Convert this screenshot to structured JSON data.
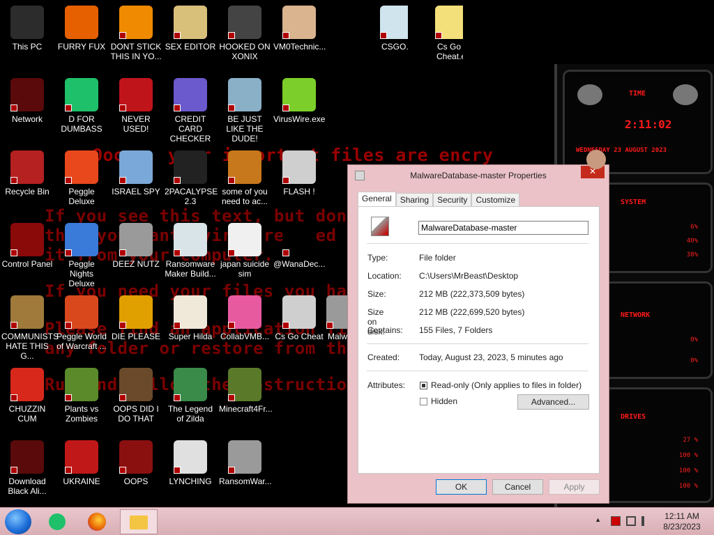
{
  "wallpaper": {
    "lines": [
      "Ooops, your important files are encry",
      "If you see this text, but don't",
      "then your anti-virus removed the",
      "it from your computer.",
      "If you need your files you have",
      "Please find an application file",
      "any folder or restore from the",
      "Run and follow the instructions"
    ]
  },
  "desktop_icons": [
    {
      "label": "This PC",
      "icon": "this-pc-icon",
      "color": "#2c2c2c"
    },
    {
      "label": "FURRY FUX",
      "icon": "firefox-icon",
      "color": "#e66000"
    },
    {
      "label": "DONT STICK THIS IN YO...",
      "icon": "vlc-cone-icon",
      "color": "#f08a00"
    },
    {
      "label": "SEX EDITOR",
      "icon": "hxd-editor-icon",
      "color": "#d9c07a"
    },
    {
      "label": "HOOKED ON XONIX",
      "icon": "xonix-game-icon",
      "color": "#444444"
    },
    {
      "label": "VM0Technic...",
      "icon": "doctor-avatar-icon",
      "color": "#d9b48f"
    },
    {
      "label": "CSGO.exe",
      "icon": "window-app-icon",
      "color": "#cfe4ec"
    },
    {
      "label": "Cs Go Cheat.exe",
      "icon": "cs-go-icon",
      "color": "#f4e07a"
    },
    {
      "label": "Network",
      "icon": "alienware-network-icon",
      "color": "#5a0a0a"
    },
    {
      "label": "D FOR DUMBASS",
      "icon": "chat-bubble-icon",
      "color": "#1fc06a"
    },
    {
      "label": "NEVER USED!",
      "icon": "dev-cpp-icon",
      "color": "#c0141b"
    },
    {
      "label": "CREDIT CARD CHECKER",
      "icon": "credit-card-icon",
      "color": "#6a5acd"
    },
    {
      "label": "BE JUST LIKE THE DUDE!",
      "icon": "santa-gnome-icon",
      "color": "#8ab0c8"
    },
    {
      "label": "VirusWire.exe",
      "icon": "lime-slice-icon",
      "color": "#7ccf2a"
    },
    {
      "label": "Recycle Bin",
      "icon": "recycle-bin-icon",
      "color": "#b52020"
    },
    {
      "label": "Peggle Deluxe",
      "icon": "peggle-icon",
      "color": "#e8481c"
    },
    {
      "label": "ISRAEL SPY",
      "icon": "network-computers-icon",
      "color": "#7aa8d8"
    },
    {
      "label": "2PACALYPSE 2.3",
      "icon": "terminal-icon",
      "color": "#222222"
    },
    {
      "label": "some of you need to ac...",
      "icon": "dog-meme-icon",
      "color": "#c8781c"
    },
    {
      "label": "FLASH !",
      "icon": "flash-card-icon",
      "color": "#cfcfcf"
    },
    {
      "label": "Control Panel",
      "icon": "control-panel-icon",
      "color": "#8a0a0a"
    },
    {
      "label": "Peggle Nights Deluxe",
      "icon": "peggle-nights-icon",
      "color": "#3a7ad8"
    },
    {
      "label": "DEEZ NUTZ",
      "icon": "stacked-windows-icon",
      "color": "#9a9a9a"
    },
    {
      "label": "Ransomware Maker Build...",
      "icon": "window-app-icon",
      "color": "#d8e4e8"
    },
    {
      "label": "japan suicide sim",
      "icon": "document-icon",
      "color": "#f0f0f0"
    },
    {
      "label": "@WanaDec...",
      "icon": "wanadecrypt-icon",
      "color": "#000000"
    },
    {
      "label": "COMMUNISTS HATE THIS G...",
      "icon": "money-bag-icon",
      "color": "#a07a3a"
    },
    {
      "label": "Peggle World of Warcraft ...",
      "icon": "peggle-wow-icon",
      "color": "#d8481c"
    },
    {
      "label": "DIE PLEASE",
      "icon": "adobe-de-icon",
      "color": "#e0a000"
    },
    {
      "label": "Super Hilda",
      "icon": "pixel-character-icon",
      "color": "#f0e8d8"
    },
    {
      "label": "CollabVMB...",
      "icon": "collabvm-icon",
      "color": "#e85aa0"
    },
    {
      "label": "Cs Go Cheat",
      "icon": "flash-card-icon",
      "color": "#cfcfcf"
    },
    {
      "label": "Malw...",
      "icon": "flash-card-icon",
      "color": "#9a9a9a"
    },
    {
      "label": "CHUZZIN CUM",
      "icon": "chuzzle-icon",
      "color": "#d8281c"
    },
    {
      "label": "Plants vs Zombies",
      "icon": "plants-vs-zombies-icon",
      "color": "#5a8a2a"
    },
    {
      "label": "OOPS DID I DO THAT",
      "icon": "portrait-icon",
      "color": "#6a4a2a"
    },
    {
      "label": "The Legend of Zilda",
      "icon": "zelda-character-icon",
      "color": "#3a8a4a"
    },
    {
      "label": "Minecraft4Fr...",
      "icon": "minecraft-block-icon",
      "color": "#5a7a2a"
    },
    {
      "label": "Download Black Ali...",
      "icon": "alienware-icon",
      "color": "#5a0a0a"
    },
    {
      "label": "UKRAINE",
      "icon": "radiation-icon",
      "color": "#c01818"
    },
    {
      "label": "OOPS",
      "icon": "red-card-icon",
      "color": "#8a1010"
    },
    {
      "label": "LYNCHING",
      "icon": "hangman-icon",
      "color": "#e0e0e0"
    },
    {
      "label": "RansomWar...",
      "icon": "skull-ring-icon",
      "color": "#9a9a9a"
    }
  ],
  "gadget": {
    "time_title": "TIME",
    "time": "2:11:02",
    "date": "WEDNESDAY 23 AUGUST 2023",
    "system_title": "SYSTEM",
    "system_values": [
      "6%",
      "40%",
      "38%"
    ],
    "network_title": "NETWORK",
    "network_values": [
      "0%",
      "0%"
    ],
    "drives_title": "DRIVES",
    "drives_values": [
      "27 %",
      "100 %",
      "100 %",
      "100 %"
    ]
  },
  "dialog": {
    "title": "MalwareDatabase-master Properties",
    "close_glyph": "✕",
    "tabs": [
      "General",
      "Sharing",
      "Security",
      "Customize"
    ],
    "name_value": "MalwareDatabase-master",
    "type_label": "Type:",
    "type_value": "File folder",
    "location_label": "Location:",
    "location_value": "C:\\Users\\MrBeast\\Desktop",
    "size_label": "Size:",
    "size_value": "212 MB (222,373,509 bytes)",
    "size_on_disk_label": "Size on disk:",
    "size_on_disk_value": "212 MB (222,699,520 bytes)",
    "contains_label": "Contains:",
    "contains_value": "155 Files, 7 Folders",
    "created_label": "Created:",
    "created_value": "Today, August 23, 2023, 5 minutes ago",
    "attributes_label": "Attributes:",
    "readonly_label": "Read-only (Only applies to files in folder)",
    "hidden_label": "Hidden",
    "advanced_label": "Advanced...",
    "ok_label": "OK",
    "cancel_label": "Cancel",
    "apply_label": "Apply"
  },
  "taskbar": {
    "time": "12:11 AM",
    "date": "8/23/2023",
    "tray_arrow": "▲",
    "colors": {
      "accent": "#e9c7cc",
      "start": "#1e6fd9"
    }
  }
}
